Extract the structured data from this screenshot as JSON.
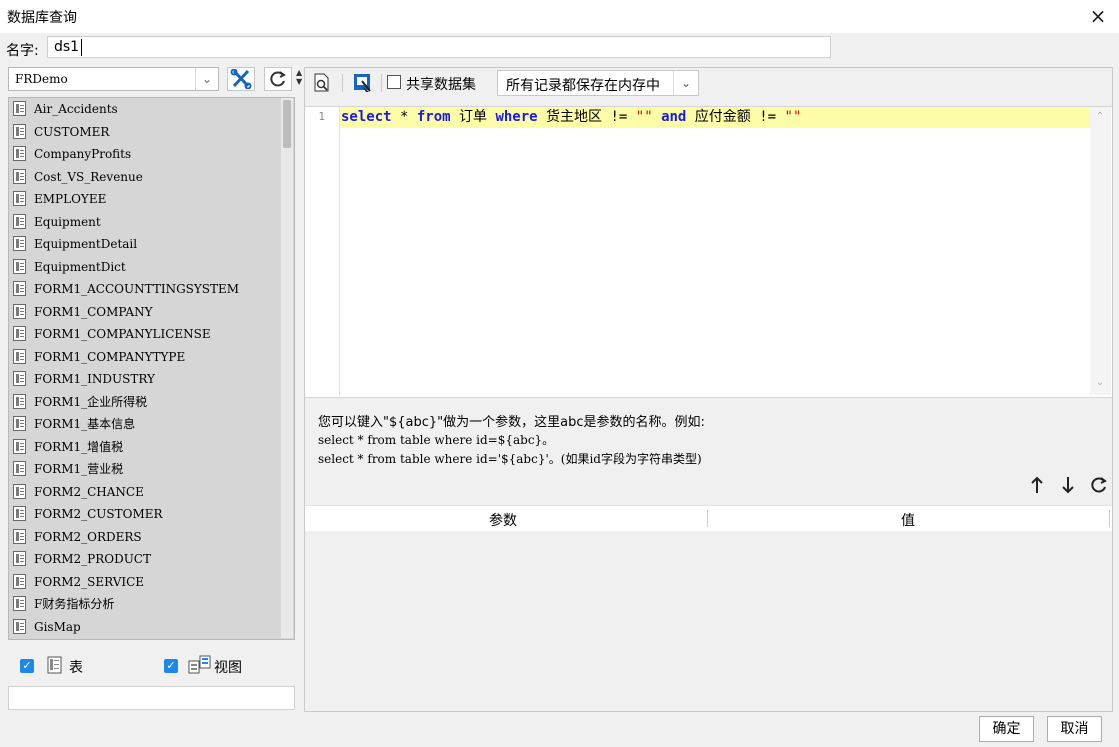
{
  "window": {
    "title": "数据库查询",
    "close_glyph": "×"
  },
  "name_field": {
    "label": "名字:",
    "value": "ds1"
  },
  "left": {
    "database": "FRDemo",
    "tables": [
      "Air_Accidents",
      "CUSTOMER",
      "CompanyProfits",
      "Cost_VS_Revenue",
      "EMPLOYEE",
      "Equipment",
      "EquipmentDetail",
      "EquipmentDict",
      "FORM1_ACCOUNTTINGSYSTEM",
      "FORM1_COMPANY",
      "FORM1_COMPANYLICENSE",
      "FORM1_COMPANYTYPE",
      "FORM1_INDUSTRY",
      "FORM1_企业所得税",
      "FORM1_基本信息",
      "FORM1_增值税",
      "FORM1_营业税",
      "FORM2_CHANCE",
      "FORM2_CUSTOMER",
      "FORM2_ORDERS",
      "FORM2_PRODUCT",
      "FORM2_SERVICE",
      "F财务指标分析",
      "GisMap"
    ],
    "filter_table_label": "表",
    "filter_view_label": "视图",
    "search_value": ""
  },
  "toolbar": {
    "share_label": "共享数据集",
    "memory_option": "所有记录都保存在内存中"
  },
  "editor": {
    "line_number": "1",
    "tokens": {
      "t1": "select",
      "t2": " * ",
      "t3": "from",
      "t4": " 订单 ",
      "t5": "where",
      "t6": " 货主地区 != ",
      "t7": "\"\"",
      "t8": " ",
      "t9": "and",
      "t10": " 应付金额 != ",
      "t11": "\"\""
    }
  },
  "hint": {
    "line1": "您可以键入\"${abc}\"做为一个参数，这里abc是参数的名称。例如:",
    "line2": "select * from table where id=${abc}。",
    "line3": "select * from table where id='${abc}'。(如果id字段为字符串类型)"
  },
  "params": {
    "col_param": "参数",
    "col_value": "值"
  },
  "footer": {
    "ok_label": "确定",
    "cancel_label": "取消"
  },
  "colors": {
    "accent": "#1e88e5",
    "keyword": "#1a1ae6",
    "string": "#cc1111",
    "current_line": "#fdfda8"
  }
}
